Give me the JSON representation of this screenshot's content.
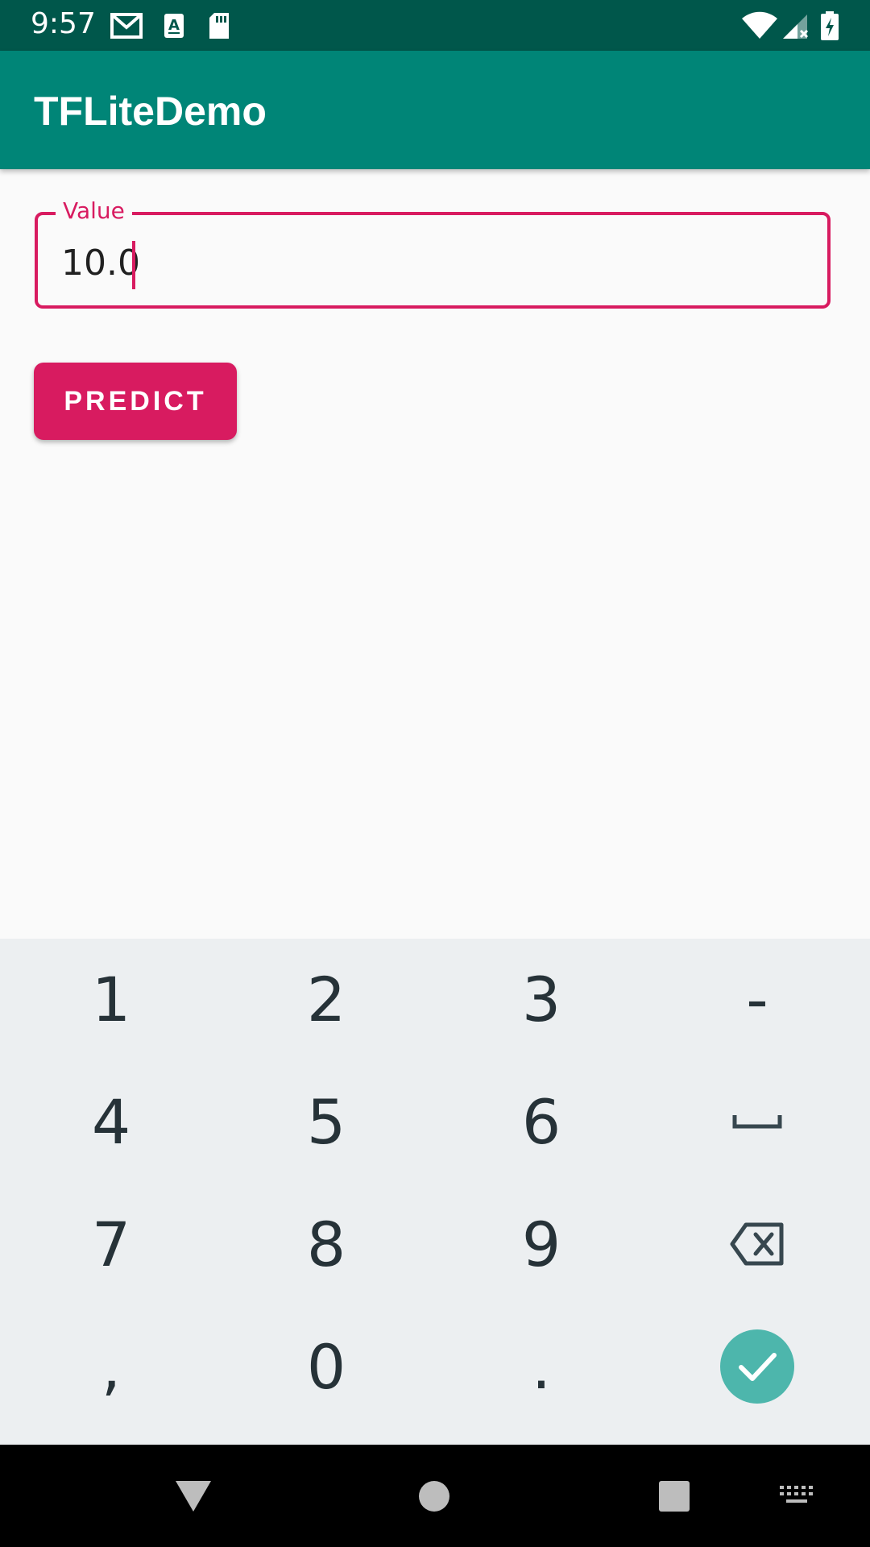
{
  "status_bar": {
    "time": "9:57",
    "left_icons": [
      "gmail-icon",
      "text-a-icon",
      "sd-card-icon"
    ],
    "right_icons": [
      "wifi-icon",
      "cell-signal-icon",
      "battery-charging-icon"
    ]
  },
  "app_bar": {
    "title": "TFLiteDemo"
  },
  "value_field": {
    "label": "Value",
    "value": "10.0"
  },
  "predict_button": {
    "label": "PREDICT"
  },
  "keyboard": {
    "rows": [
      [
        "1",
        "2",
        "3",
        "-"
      ],
      [
        "4",
        "5",
        "6",
        "space-icon"
      ],
      [
        "7",
        "8",
        "9",
        "backspace-icon"
      ],
      [
        ",",
        "0",
        ".",
        "enter-check-icon"
      ]
    ]
  },
  "nav_bar": {
    "icons": [
      "back-icon",
      "home-icon",
      "recents-icon",
      "keyboard-switch-icon"
    ]
  },
  "colors": {
    "status_bar": "#00574b",
    "app_bar": "#008577",
    "accent": "#d81b60",
    "keyboard_bg": "#eceff1",
    "enter_key": "#4db6ac"
  }
}
